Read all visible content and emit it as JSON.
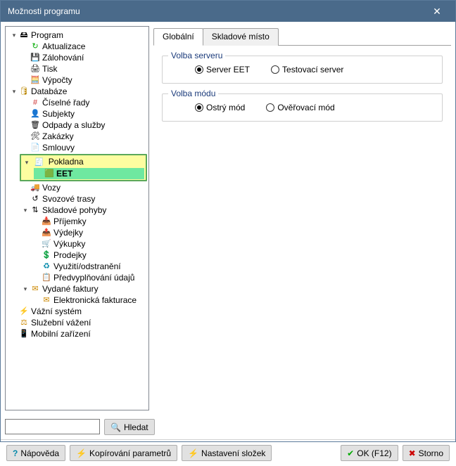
{
  "window": {
    "title": "Možnosti programu"
  },
  "tree": {
    "program": {
      "label": "Program",
      "aktualizace": "Aktualizace",
      "zalohovani": "Zálohování",
      "tisk": "Tisk",
      "vypocty": "Výpočty"
    },
    "databaze": {
      "label": "Databáze",
      "ciselne_rady": "Číselné řady",
      "subjekty": "Subjekty",
      "odpady_sluzby": "Odpady a služby",
      "zakazky": "Zakázky",
      "smlouvy": "Smlouvy",
      "pokladna": {
        "label": "Pokladna",
        "eet": "EET"
      },
      "vozy": "Vozy",
      "svozove_trasy": "Svozové trasy",
      "skladove_pohyby": {
        "label": "Skladové pohyby",
        "prijemky": "Příjemky",
        "vydejky": "Výdejky",
        "vykupky": "Výkupky",
        "prodejky": "Prodejky",
        "vyuziti": "Využití/odstranění",
        "predvyplnovani": "Předvyplňování údajů"
      },
      "vydane_faktury": {
        "label": "Vydané faktury",
        "el_fakturace": "Elektronická fakturace"
      }
    },
    "vazni_system": "Vážní systém",
    "sluzebni_vazeni": "Služební vážení",
    "mobilni_zarizeni": "Mobilní zařízení"
  },
  "tabs": {
    "globalni": "Globální",
    "skladove_misto": "Skladové místo"
  },
  "group_server": {
    "title": "Volba serveru",
    "opt1": "Server EET",
    "opt2": "Testovací server",
    "selected": "opt1"
  },
  "group_mode": {
    "title": "Volba módu",
    "opt1": "Ostrý mód",
    "opt2": "Ověřovací mód",
    "selected": "opt1"
  },
  "search": {
    "button": "Hledat"
  },
  "footer": {
    "napoveda": "Nápověda",
    "kopirovani": "Kopírování parametrů",
    "nastaveni": "Nastavení složek",
    "ok": "OK (F12)",
    "storno": "Storno"
  },
  "icons": {
    "program": "🖴",
    "refresh": "↻",
    "save_disk": "💾",
    "printer": "🖨",
    "calc": "🧮",
    "db": "🛢",
    "hash": "#",
    "person": "👤",
    "trash": "🗑",
    "hammer": "🛠",
    "doc": "📄",
    "register": "🧾",
    "eet": "🟩",
    "car": "🚚",
    "route": "↺",
    "warehouse": "⇅",
    "in": "📥",
    "out": "📤",
    "buy": "🛒",
    "sell": "💲",
    "recycle": "♻",
    "prefill": "📋",
    "invoice": "✉",
    "mail": "✉",
    "bolt": "⚡",
    "scale": "⚖",
    "mobile": "📱",
    "search": "🔍",
    "help": "?",
    "copy_bolt": "⚡",
    "folder_bolt": "⚡",
    "check": "✔",
    "cross": "✖"
  }
}
